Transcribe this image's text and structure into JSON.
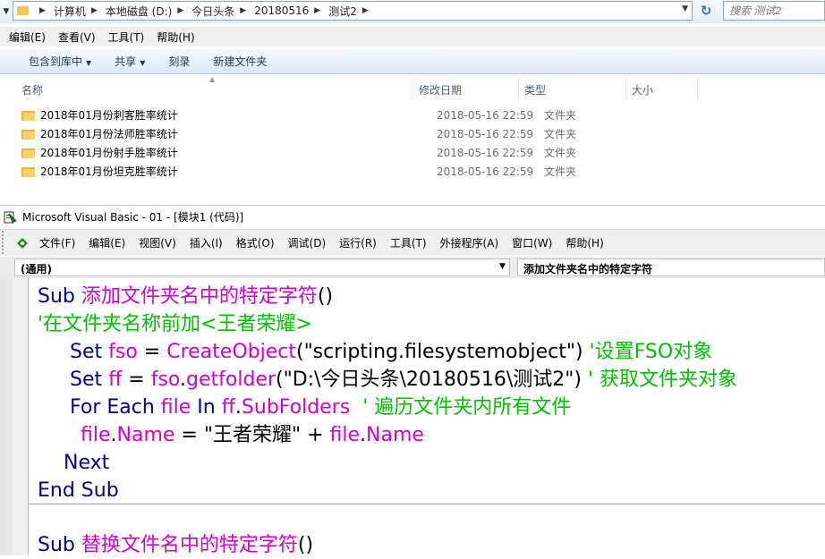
{
  "explorer": {
    "breadcrumb": [
      "计算机",
      "本地磁盘 (D:)",
      "今日头条",
      "20180516",
      "测试2"
    ],
    "search_placeholder": "搜索 测试2",
    "menu": [
      "编辑(E)",
      "查看(V)",
      "工具(T)",
      "帮助(H)"
    ],
    "commands": [
      {
        "label": "包含到库中",
        "dropdown": true
      },
      {
        "label": "共享",
        "dropdown": true
      },
      {
        "label": "刻录",
        "dropdown": false
      },
      {
        "label": "新建文件夹",
        "dropdown": false
      }
    ],
    "columns": [
      "名称",
      "修改日期",
      "类型",
      "大小"
    ],
    "files": [
      {
        "name": "2018年01月份刺客胜率统计",
        "date": "2018-05-16 22:59",
        "type": "文件夹"
      },
      {
        "name": "2018年01月份法师胜率统计",
        "date": "2018-05-16 22:59",
        "type": "文件夹"
      },
      {
        "name": "2018年01月份射手胜率统计",
        "date": "2018-05-16 22:59",
        "type": "文件夹"
      },
      {
        "name": "2018年01月份坦克胜率统计",
        "date": "2018-05-16 22:59",
        "type": "文件夹"
      }
    ]
  },
  "vbe": {
    "title": "Microsoft Visual Basic - 01 - [模块1 (代码)]",
    "menu": [
      "文件(F)",
      "编辑(E)",
      "视图(V)",
      "插入(I)",
      "格式(O)",
      "调试(D)",
      "运行(R)",
      "工具(T)",
      "外接程序(A)",
      "窗口(W)",
      "帮助(H)"
    ],
    "object_combo": "(通用)",
    "proc_combo": "添加文件夹名中的特定字符",
    "code": {
      "l1": [
        "Sub ",
        "添加文件夹名中的特定字符",
        "()"
      ],
      "l2": [
        "'在文件夹名称前加<王者荣耀>"
      ],
      "l3": [
        "Set ",
        "fso",
        " = ",
        "CreateObject",
        "(\"scripting.filesystemobject\") ",
        "'设置FSO对象"
      ],
      "l4": [
        "Set ",
        "ff",
        " = ",
        "fso",
        ".",
        "getfolder",
        "(\"D:\\今日头条\\20180516\\测试2\") ",
        "' 获取文件夹对象"
      ],
      "l5": [
        "For Each ",
        "file",
        " In ",
        "ff",
        ".",
        "SubFolders",
        "  ",
        "' 遍历文件夹内所有文件"
      ],
      "l6": [
        "file",
        ".",
        "Name",
        " = \"王者荣耀\" + ",
        "file",
        ".",
        "Name"
      ],
      "l7": [
        "Next"
      ],
      "l8": [
        "End Sub"
      ],
      "l9": [
        "Sub ",
        "替换文件名中的特定字符",
        "()"
      ]
    }
  }
}
